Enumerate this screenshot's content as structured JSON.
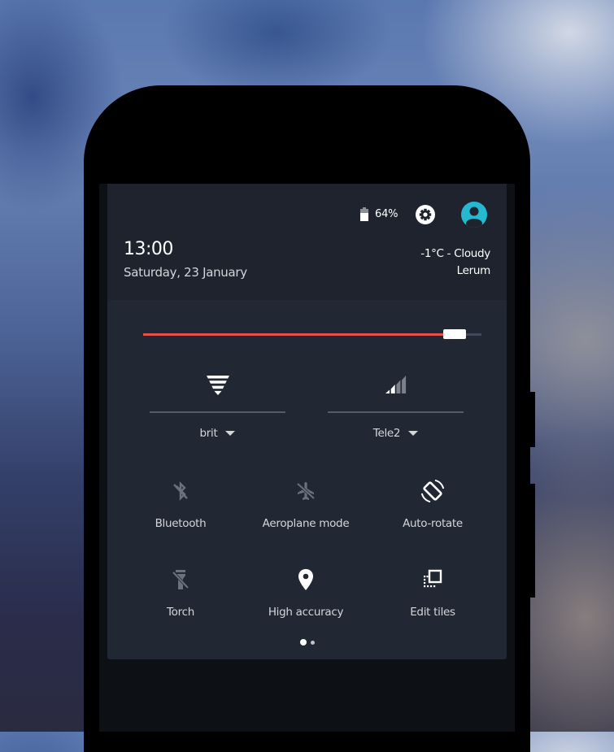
{
  "status": {
    "battery_label": "64%",
    "battery_level": 0.64,
    "icons": {
      "battery": "battery-icon",
      "settings": "gear-icon",
      "user": "account-circle-icon"
    },
    "accent_color": "#26b8d0"
  },
  "header": {
    "time": "13:00",
    "date": "Saturday, 23 January",
    "weather": "-1°C - Cloudy",
    "location": "Lerum"
  },
  "brightness": {
    "value": 0.95,
    "fill_color": "#e3504e"
  },
  "network": {
    "wifi": {
      "icon": "wifi-signal-icon",
      "ssid": "brit",
      "signal_level": 4
    },
    "cellular": {
      "icon": "cellular-signal-icon",
      "carrier": "Tele2",
      "signal_bars": 2,
      "signal_max": 4
    }
  },
  "tiles": [
    {
      "label": "Bluetooth",
      "icon": "bluetooth-disabled-icon",
      "active": false
    },
    {
      "label": "Aeroplane mode",
      "icon": "airplane-off-icon",
      "active": false
    },
    {
      "label": "Auto-rotate",
      "icon": "screen-rotation-icon",
      "active": true
    },
    {
      "label": "Torch",
      "icon": "flashlight-off-icon",
      "active": false
    },
    {
      "label": "High accuracy",
      "icon": "location-pin-icon",
      "active": true
    },
    {
      "label": "Edit tiles",
      "icon": "edit-tiles-icon",
      "active": true
    }
  ],
  "pager": {
    "current_page": 1,
    "total_pages": 2
  }
}
